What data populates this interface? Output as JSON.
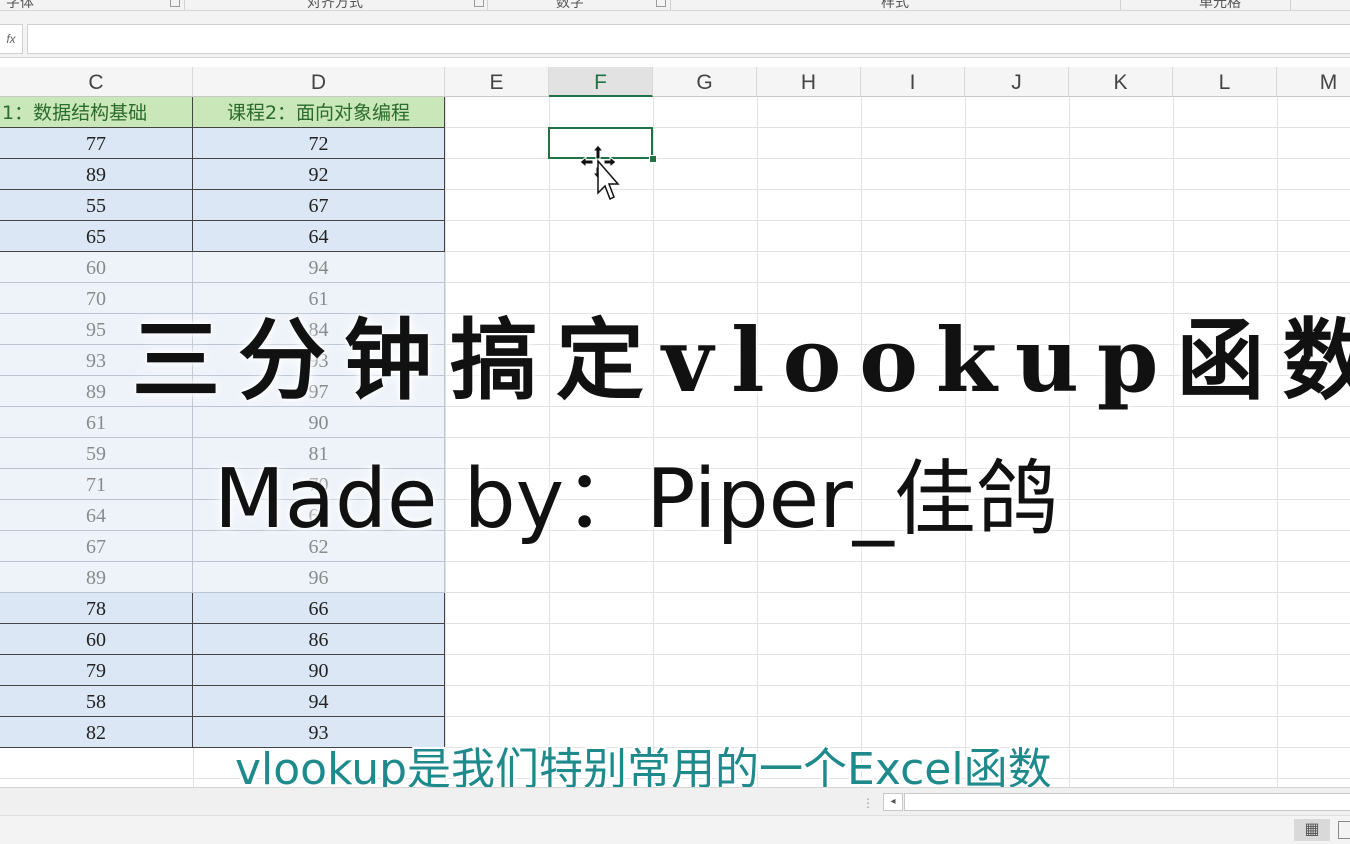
{
  "ribbon": {
    "groups": [
      "字体",
      "对齐方式",
      "数字",
      "样式",
      "单元格"
    ]
  },
  "formula_bar": {
    "fx_label": "fx",
    "value": ""
  },
  "columns": [
    "C",
    "D",
    "E",
    "F",
    "G",
    "H",
    "I",
    "J",
    "K",
    "L",
    "M"
  ],
  "selected_column": "F",
  "table": {
    "headers": [
      "1：数据结构基础",
      "课程2：面向对象编程"
    ],
    "rows": [
      [
        "77",
        "72"
      ],
      [
        "89",
        "92"
      ],
      [
        "55",
        "67"
      ],
      [
        "65",
        "64"
      ],
      [
        "60",
        "94"
      ],
      [
        "70",
        "61"
      ],
      [
        "95",
        "84"
      ],
      [
        "93",
        "93"
      ],
      [
        "89",
        "97"
      ],
      [
        "61",
        "90"
      ],
      [
        "59",
        "81"
      ],
      [
        "71",
        "70"
      ],
      [
        "64",
        "69"
      ],
      [
        "67",
        "62"
      ],
      [
        "89",
        "96"
      ],
      [
        "78",
        "66"
      ],
      [
        "60",
        "86"
      ],
      [
        "79",
        "90"
      ],
      [
        "58",
        "94"
      ],
      [
        "82",
        "93"
      ]
    ]
  },
  "overlay": {
    "title": "三分钟搞定vlookup函数",
    "author": "Made by：Piper_佳鸽"
  },
  "subtitle": "vlookup是我们特别常用的一个Excel函数",
  "status": {
    "scroll_left": "◂",
    "view_normal_icon": "▦"
  },
  "colors": {
    "header_green": "#c9e7b8",
    "cell_blue": "#dbe7f5",
    "selection_green": "#217346",
    "subtitle_teal": "#1f8a8c"
  }
}
